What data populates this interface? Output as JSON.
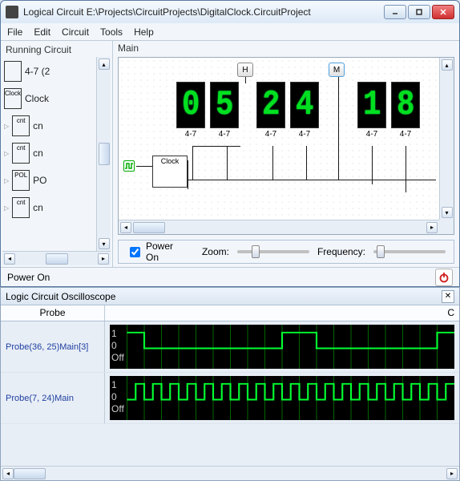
{
  "window": {
    "title": "Logical Circuit E:\\Projects\\CircuitProjects\\DigitalClock.CircuitProject"
  },
  "menu": {
    "file": "File",
    "edit": "Edit",
    "circuit": "Circuit",
    "tools": "Tools",
    "help": "Help"
  },
  "sidebar": {
    "title": "Running Circuit",
    "items": [
      {
        "chip": "",
        "label": "4-7 (2"
      },
      {
        "chip": "Clock",
        "label": "Clock"
      },
      {
        "chip": "cnt",
        "label": "cn"
      },
      {
        "chip": "cnt",
        "label": "cn"
      },
      {
        "chip": "POL",
        "label": "PO"
      },
      {
        "chip": "cnt",
        "label": "cn"
      }
    ]
  },
  "main": {
    "title": "Main",
    "button_h": "H",
    "button_m": "M",
    "seg_label": "4-7",
    "digits": [
      "0",
      "5",
      "2",
      "4",
      "1",
      "8"
    ],
    "clock_chip": "Clock"
  },
  "controls": {
    "power_on": "Power On",
    "power_checked": true,
    "zoom": "Zoom:",
    "frequency": "Frequency:"
  },
  "status": {
    "text": "Power On"
  },
  "oscilloscope": {
    "title": "Logic Circuit Oscilloscope",
    "col_probe": "Probe",
    "col_chan": "C",
    "rows": [
      {
        "label": "Probe(36, 25)Main[3]",
        "levels": [
          "1",
          "0",
          "Off"
        ]
      },
      {
        "label": "Probe(7, 24)Main",
        "levels": [
          "1",
          "0",
          "Off"
        ]
      }
    ]
  }
}
